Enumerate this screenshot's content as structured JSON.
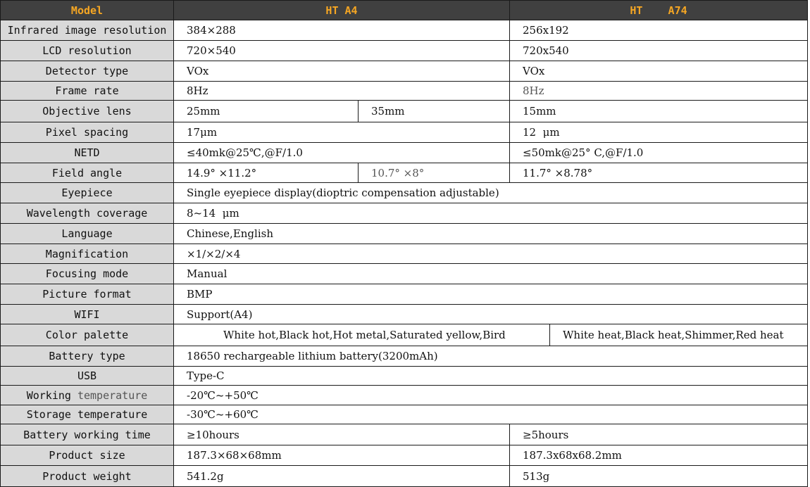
{
  "header": {
    "model_label": "Model",
    "col_a4": "HT A4",
    "col_a74": "HT    A74"
  },
  "rows": {
    "ir_res": {
      "label": "Infrared image resolution",
      "a4": "384×288",
      "a74": "256x192"
    },
    "lcd_res": {
      "label": "LCD resolution",
      "a4": "720×540",
      "a74": "720x540"
    },
    "detector": {
      "label": "Detector type",
      "a4": "VOx",
      "a74": "VOx"
    },
    "frame_rate": {
      "label": "Frame rate",
      "a4": "8Hz",
      "a74": "8Hz"
    },
    "lens": {
      "label": "Objective lens",
      "a4_1": "25mm",
      "a4_2": "35mm",
      "a74": "15mm"
    },
    "pixel": {
      "label": "Pixel spacing",
      "a4": "17μm",
      "a74": "12  μm"
    },
    "netd": {
      "label": "NETD",
      "a4": "≤40mk@25℃,@F/1.0",
      "a74": "≤50mk@25° C,@F/1.0"
    },
    "field": {
      "label": "Field angle",
      "a4_1": "14.9° ×11.2°",
      "a4_2": "10.7° ×8°",
      "a74": "11.7° ×8.78°"
    },
    "eyepiece": {
      "label": "Eyepiece",
      "value": "Single eyepiece display(dioptric compensation adjustable)"
    },
    "wavelength": {
      "label": "Wavelength coverage",
      "value": "8~14  μm"
    },
    "language": {
      "label": "Language",
      "value": "Chinese,English"
    },
    "magnification": {
      "label": "Magnification",
      "value": "×1/×2/×4"
    },
    "focusing": {
      "label": "Focusing mode",
      "value": "Manual"
    },
    "picture": {
      "label": "Picture format",
      "value": "BMP"
    },
    "wifi": {
      "label": "WIFI",
      "value": "Support(A4)"
    },
    "palette": {
      "label": "Color palette",
      "a4": "White hot,Black hot,Hot metal,Saturated yellow,Bird",
      "a74": "White heat,Black heat,Shimmer,Red heat"
    },
    "battery_type": {
      "label": "Battery type",
      "value": "18650 rechargeable lithium battery(3200mAh)"
    },
    "usb": {
      "label": "USB",
      "value": "Type-C"
    },
    "work_temp": {
      "label_a": "Working",
      "label_b": "temperature",
      "value": "-20℃~+50℃"
    },
    "store_temp": {
      "label": "Storage temperature",
      "value": "-30℃~+60℃"
    },
    "battery_time": {
      "label": "Battery working time",
      "a4": "≥10hours",
      "a74": "≥5hours"
    },
    "size": {
      "label": "Product size",
      "a4": "187.3×68×68mm",
      "a74": "187.3x68x68.2mm"
    },
    "weight": {
      "label": "Product weight",
      "a4": "541.2g",
      "a74": "513g"
    }
  }
}
